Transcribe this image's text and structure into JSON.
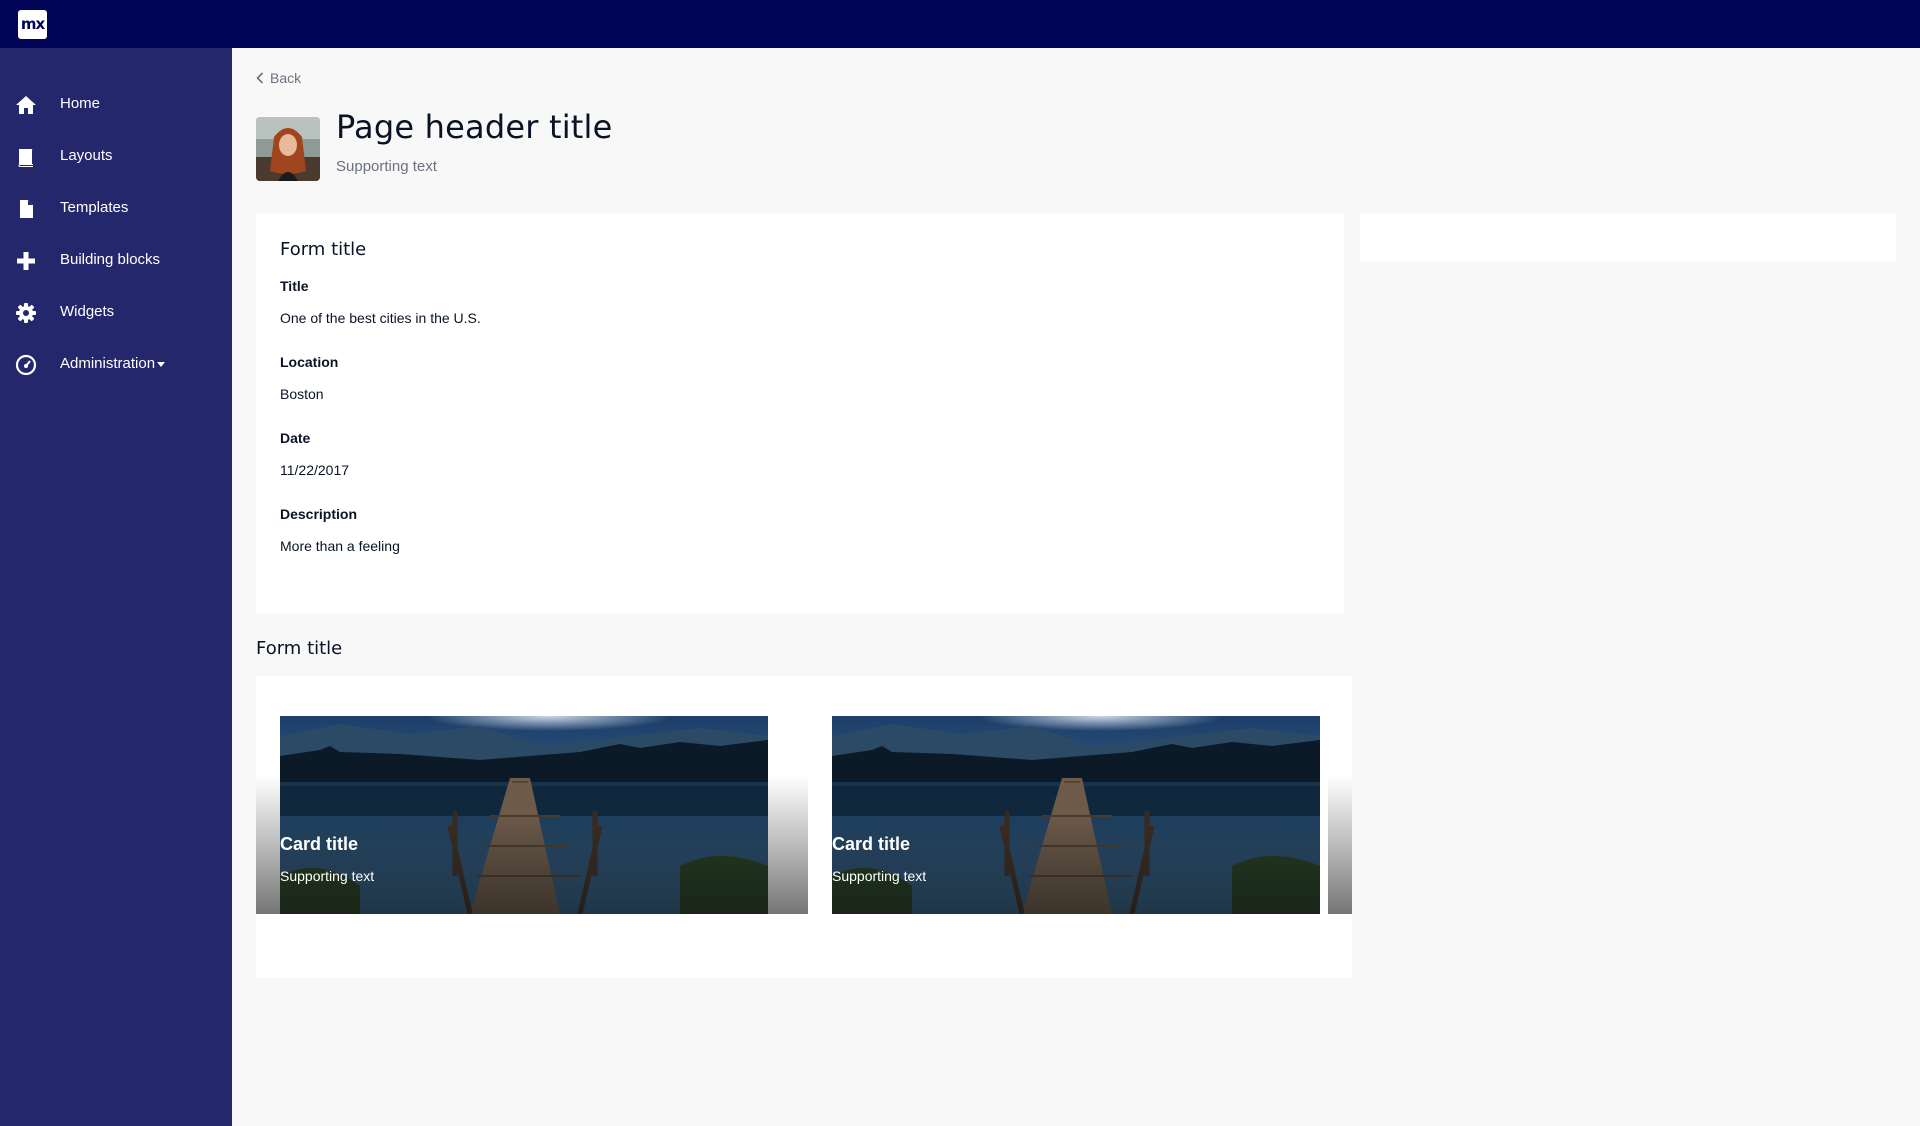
{
  "app": {
    "logo_text": "mx",
    "brand_color": "#020557",
    "sidebar_color": "#24276c"
  },
  "sidebar": {
    "items": [
      {
        "label": "Home",
        "icon": "home-icon"
      },
      {
        "label": "Layouts",
        "icon": "book-icon"
      },
      {
        "label": "Templates",
        "icon": "file-icon"
      },
      {
        "label": "Building blocks",
        "icon": "plus-icon"
      },
      {
        "label": "Widgets",
        "icon": "gear-icon"
      },
      {
        "label": "Administration",
        "icon": "dashboard-icon",
        "has_dropdown": true
      }
    ]
  },
  "header": {
    "back_label": "Back",
    "title": "Page header title",
    "subtitle": "Supporting text"
  },
  "form": {
    "title": "Form title",
    "fields": [
      {
        "label": "Title",
        "value": "One of the best cities in the U.S."
      },
      {
        "label": "Location",
        "value": "Boston"
      },
      {
        "label": "Date",
        "value": "11/22/2017"
      },
      {
        "label": "Description",
        "value": "More than a feeling"
      }
    ]
  },
  "cards_section": {
    "title": "Form title",
    "cards": [
      {
        "title": "Card title",
        "subtitle": "Supporting text"
      },
      {
        "title": "Card title",
        "subtitle": "Supporting text"
      }
    ]
  }
}
